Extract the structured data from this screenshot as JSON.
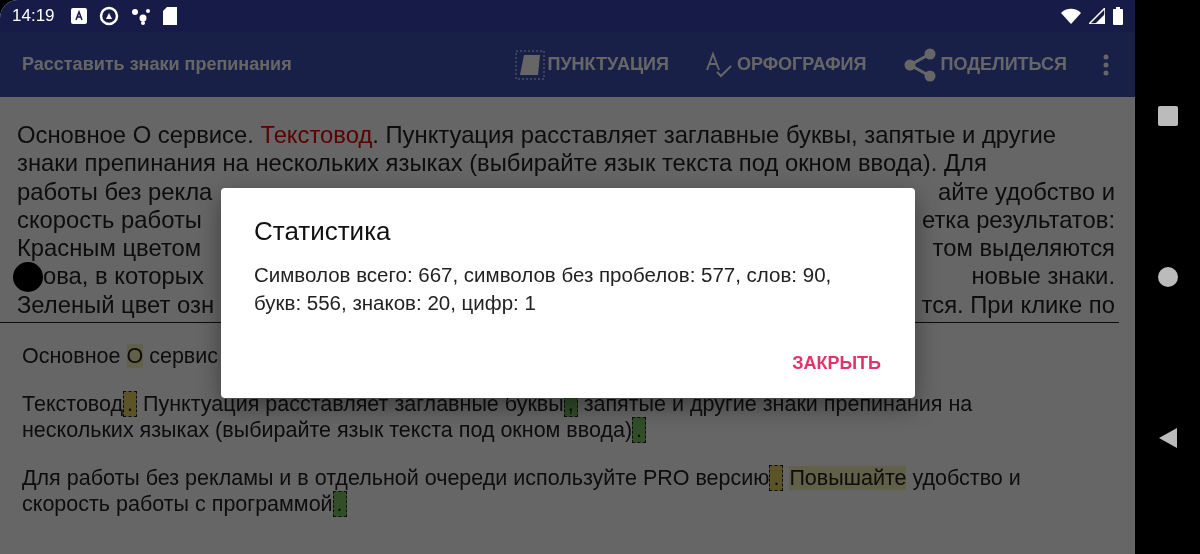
{
  "status_bar": {
    "time": "14:19"
  },
  "app_bar": {
    "title": "Расставить знаки препинания",
    "actions": [
      {
        "kind": "punctuation",
        "label": "ПУНКТУАЦИЯ"
      },
      {
        "kind": "spelling",
        "label": "ОРФОГРАФИЯ"
      },
      {
        "kind": "share",
        "label": "ПОДЕЛИТЬСЯ"
      }
    ]
  },
  "input_text": {
    "lines": [
      {
        "left": [
          {
            "kind": "plain",
            "text": "Основное О сервисе. "
          },
          {
            "kind": "error",
            "text": "Текстовод"
          },
          {
            "kind": "plain",
            "text": ". Пунктуация расставляет заглавные буквы, запятые и другие"
          }
        ]
      },
      {
        "left": [
          {
            "kind": "plain",
            "text": "знаки препинания на нескольких языках (выбирайте язык текста под окном ввода). Для"
          }
        ]
      },
      {
        "left": [
          {
            "kind": "plain",
            "text": "работы без рекла"
          }
        ],
        "right": [
          {
            "kind": "plain",
            "text": "айте удобство и"
          }
        ]
      },
      {
        "left": [
          {
            "kind": "plain",
            "text": "скорость работы"
          }
        ],
        "right": [
          {
            "kind": "plain",
            "text": "етка результатов:"
          }
        ]
      },
      {
        "left": [
          {
            "kind": "plain",
            "text": "Красным цветом"
          }
        ],
        "right": [
          {
            "kind": "plain",
            "text": "том выделяются"
          }
        ]
      },
      {
        "touch": true,
        "left": [
          {
            "kind": "plain",
            "text": "ова, в которых"
          }
        ],
        "right": [
          {
            "kind": "plain",
            "text": "новые знаки."
          }
        ]
      },
      {
        "left": [
          {
            "kind": "plain",
            "text": "Зеленый цвет озн"
          }
        ],
        "right": [
          {
            "kind": "plain",
            "text": "тся. При клике по"
          }
        ]
      }
    ]
  },
  "result": {
    "paragraphs": [
      {
        "lines": [
          [
            {
              "kind": "plain",
              "text": "Основное "
            },
            {
              "kind": "highlight",
              "text": "О"
            },
            {
              "kind": "plain",
              "text": " сервис"
            }
          ]
        ]
      },
      {
        "lines": [
          [
            {
              "kind": "plain",
              "text": "Текстовод"
            },
            {
              "kind": "corrected",
              "text": "."
            },
            {
              "kind": "plain",
              "text": "Пунктуация расставляет заглавные буквы"
            },
            {
              "kind": "inserted",
              "text": ","
            },
            {
              "kind": "plain",
              "text": "запятые и другие знаки препинания на"
            }
          ],
          [
            {
              "kind": "plain",
              "text": "нескольких языках (выбирайте язык текста под окном ввода)"
            },
            {
              "kind": "inserted",
              "text": "."
            }
          ]
        ]
      },
      {
        "lines": [
          [
            {
              "kind": "plain",
              "text": "Для работы без рекламы и в отдельной очереди используйте PRO версию"
            },
            {
              "kind": "corrected",
              "text": "."
            },
            {
              "kind": "highlight",
              "text": "Повышайте"
            },
            {
              "kind": "plain",
              "text": " удобство и"
            }
          ],
          [
            {
              "kind": "plain",
              "text": "скорость работы с программой"
            },
            {
              "kind": "inserted",
              "text": "."
            }
          ]
        ]
      }
    ]
  },
  "dialog": {
    "title": "Статистика",
    "body": "Символов всего: 667, символов без пробелов: 577, слов: 90, букв: 556, знаков: 20, цифр: 1",
    "button": "ЗАКРЫТЬ"
  }
}
